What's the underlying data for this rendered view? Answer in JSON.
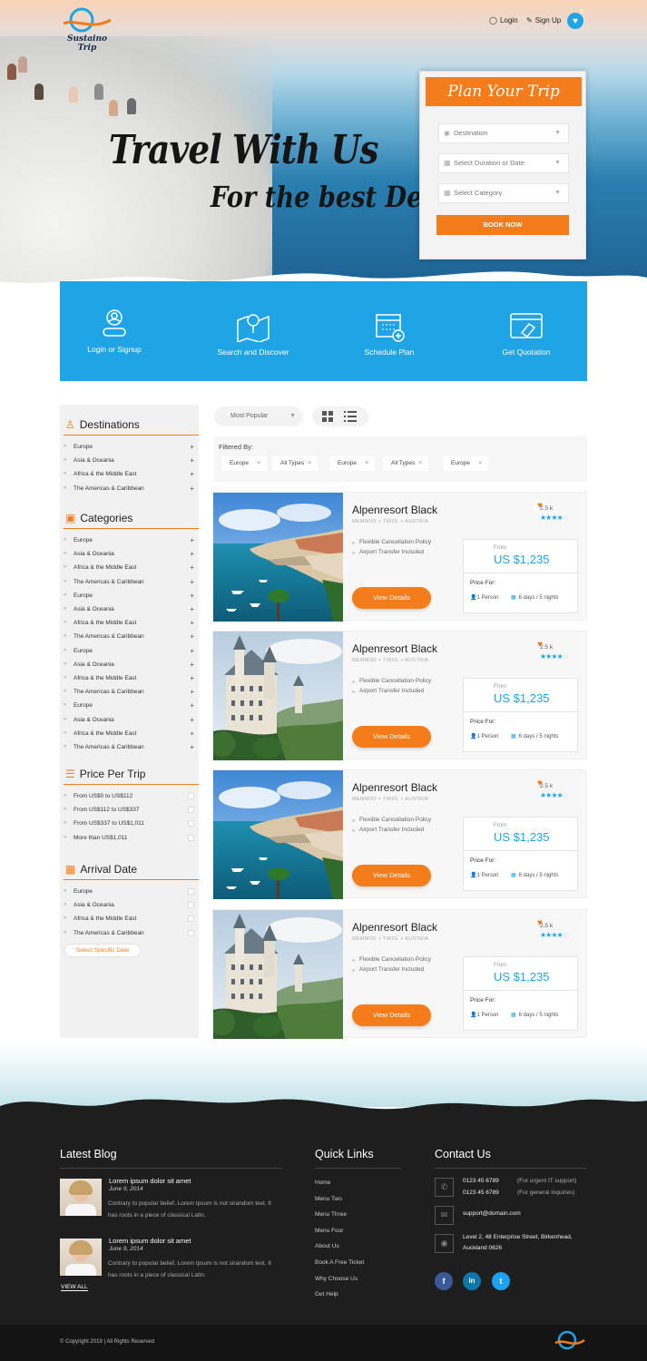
{
  "header": {
    "logo_text": "Sustaino Trip",
    "login": "Login",
    "signup": "Sign Up",
    "favorites_count": "2"
  },
  "hero": {
    "title": "Travel With Us",
    "subtitle": "For the best Deal"
  },
  "plan": {
    "title": "Plan Your Trip",
    "destination_placeholder": "Destination",
    "duration_placeholder": "Select Duration or Date",
    "category_placeholder": "Select Category",
    "book_label": "BOOK NOW"
  },
  "steps": [
    {
      "label": "Login or Signup"
    },
    {
      "label": "Search and Discover"
    },
    {
      "label": "Schedule Plan"
    },
    {
      "label": "Get Quotation"
    }
  ],
  "sidebar": {
    "destinations": {
      "title": "Destinations",
      "items": [
        "Europe",
        "Asia & Oceania",
        "Africa & the Middle East",
        "The Americas & Caribbean"
      ]
    },
    "categories": {
      "title": "Categories",
      "items": [
        "Europe",
        "Asia & Oceania",
        "Africa & the Middle East",
        "The Americas & Caribbean",
        "Europe",
        "Asia & Oceania",
        "Africa & the Middle East",
        "The Americas & Caribbean",
        "Europe",
        "Asia & Oceania",
        "Africa & the Middle East",
        "The Americas & Caribbean",
        "Europe",
        "Asia & Oceania",
        "Africa & the Middle East",
        "The Americas & Caribbean"
      ]
    },
    "price": {
      "title": "Price Per Trip",
      "items": [
        "From US$0 to US$112",
        "From US$112 to US$337",
        "From US$337 to US$1,011",
        "More than US$1,011"
      ]
    },
    "arrival": {
      "title": "Arrival Date",
      "items": [
        "Europe",
        "Asia & Oceania",
        "Africa & the Middle East",
        "The Americas & Caribbean"
      ],
      "select_date": "Select Specific Date"
    }
  },
  "toolbar": {
    "sort_value": "Most Popular",
    "filtered_label": "Filtered By:",
    "filters": [
      "Europe",
      "All Types",
      "Europe",
      "All Types",
      "Europe"
    ]
  },
  "cards": [
    {
      "image": "coastal-town",
      "title": "Alpenresort Black",
      "location": "MEMMIIO > TIROL > AUSTRIA",
      "reviews": "2.5 k",
      "rating": 3.5,
      "feature1": "Flexible Cancellation Policy",
      "feature2": "Airport Transfer Included",
      "from_label": "From",
      "price": "US $1,235",
      "price_for": "Price For:",
      "persons": "1 Person",
      "duration": "6 days / 5 nights",
      "button": "View Details"
    },
    {
      "image": "castle",
      "title": "Alpenresort Black",
      "location": "MEMMIIO > TIROL > AUSTRIA",
      "reviews": "2.5 k",
      "rating": 3.5,
      "feature1": "Flexible Cancellation Policy",
      "feature2": "Airport Transfer Included",
      "from_label": "From",
      "price": "US $1,235",
      "price_for": "Price For:",
      "persons": "1 Person",
      "duration": "6 days / 5 nights",
      "button": "View Details"
    },
    {
      "image": "coastal-town",
      "title": "Alpenresort Black",
      "location": "MEMMIIO > TIROL > AUSTRIA",
      "reviews": "2.5 k",
      "rating": 3.5,
      "feature1": "Flexible Cancellation Policy",
      "feature2": "Airport Transfer Included",
      "from_label": "From",
      "price": "US $1,235",
      "price_for": "Price For:",
      "persons": "1 Person",
      "duration": "6 days / 5 nights",
      "button": "View Details"
    },
    {
      "image": "castle",
      "title": "Alpenresort Black",
      "location": "MEMMIIO > TIROL > AUSTRIA",
      "reviews": "2.5 k",
      "rating": 3.5,
      "feature1": "Flexible Cancellation Policy",
      "feature2": "Airport Transfer Included",
      "from_label": "From",
      "price": "US $1,235",
      "price_for": "Price For:",
      "persons": "1 Person",
      "duration": "6 days / 5 nights",
      "button": "View Details"
    }
  ],
  "footer": {
    "blog_title": "Latest Blog",
    "blog": [
      {
        "title": "Lorem ipsum dolor sit amet",
        "date": "June 9, 2014",
        "text": "Contrary to popular belief, Lorem Ipsum is not sirandom text. It has roots in a piece of classical Latin."
      },
      {
        "title": "Lorem ipsum dolor sit amet",
        "date": "June 9, 2014",
        "text": "Contrary to popular belief, Lorem Ipsum is not sirandom text. It has roots in a piece of classical Latin."
      }
    ],
    "view_all": "VIEW ALL",
    "links_title": "Quick Links",
    "links": [
      "Home",
      "Menu Two",
      "Menu Three",
      "Menu Four",
      "About Us",
      "Book A Free Ticket",
      "Why Choose Us",
      "Get Help"
    ],
    "contact_title": "Contact Us",
    "phone1": "0123 45 6789",
    "phone1_note": "(For urgent IT support)",
    "phone2": "0123 45 6789",
    "phone2_note": "(For general inquiries)",
    "email": "support@domain.com",
    "address": "Level 2, 48 Enterprise Street, Birkenhead, Auckland 0626",
    "social": [
      "f",
      "in",
      "t"
    ],
    "copyright": "© Copyright 2019 | All Rights Reserved"
  },
  "colors": {
    "accent": "#f47c1a",
    "primary": "#1fa5e6",
    "footer": "#1e1e1e"
  }
}
